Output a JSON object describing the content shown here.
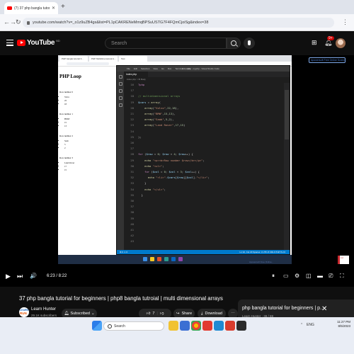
{
  "browser": {
    "tab_title": "(7) 37 php bangla tutorial for be",
    "tab_close": "✕",
    "new_tab": "+",
    "back": "←",
    "forward": "→",
    "reload": "↻",
    "url": "youtube.com/watch?v=_o1z9uZB4gs&list=PL1pCAKRENeMmqBPSuUSTG7F4FQmCjoiSg&index=38",
    "menu": "⋮"
  },
  "youtube_header": {
    "logo_text": "YouTube",
    "logo_cc": "BD",
    "search_placeholder": "Search",
    "notification_count": "9+"
  },
  "video_frame": {
    "inner_tabs": [
      "PHP bangla tutorial 3...",
      "PHP Multidimensional A...",
      "Test"
    ],
    "webpage": {
      "title": "PHP Loop",
      "sections": [
        {
          "title": "Row number 0",
          "items": [
            "Volvo",
            "22",
            "18"
          ]
        },
        {
          "title": "Row number 1",
          "items": [
            "BMW",
            "15",
            "13"
          ]
        },
        {
          "title": "Row number 2",
          "items": [
            "Saab",
            "5",
            "2"
          ]
        },
        {
          "title": "Row number 3",
          "items": [
            "Land Rover",
            "17",
            "15"
          ]
        }
      ]
    },
    "vscode": {
      "menu": [
        "File",
        "Edit",
        "Selection",
        "View",
        "Go",
        "Run",
        "Terminal",
        "Help"
      ],
      "window_title": "index.php - myphp - Visual Studio Code",
      "tab": "index.php",
      "breadcrumb": "index.php > ⚙ Body",
      "line_numbers": [
        "16",
        "17",
        "18",
        "19",
        "20",
        "21",
        "22",
        "23",
        "24",
        "25",
        "26",
        "27",
        "28",
        "29",
        "30",
        "31",
        "32",
        "33",
        "34",
        "35",
        "36",
        "37",
        "38",
        "39",
        "40",
        "41",
        "42",
        "43"
      ],
      "status_left": "⊗ 0 ⚠ 0",
      "status_right": "Ln 32, Col 29   Spaces: 4   UTF-8   CRLF   PHP   8.2.0"
    },
    "watermark": "Apowersoft Free Online Screen Recorder",
    "credit": "Apowersoft Free Online...",
    "chip_text": "LH"
  },
  "player": {
    "progress_fraction": 0.76,
    "time": "6:23 / 8:22",
    "play_icon": "▶",
    "next_icon": "⏭",
    "volume_icon": "🔊"
  },
  "video_info": {
    "title": "37 php bangla tutorial for beginners | php8 bangla tutroial | multi dimensional arrays",
    "channel": "Learn Hunter",
    "subscribers": "29.1K subscribers",
    "channel_logo_top": "LEARN",
    "channel_logo_bottom": "RUN",
    "subscribe_label": "Subscribed",
    "likes": "7",
    "share_label": "Share",
    "download_label": "Download",
    "more": "⋯"
  },
  "playlist": {
    "title": "php bangla tutorial for beginners | p...",
    "subtitle": "Learn Hunter · 38 / 69",
    "close": "✕"
  },
  "taskbar": {
    "search_label": "Search",
    "time": "11:27 PM",
    "date": "8/5/2023",
    "language": "ENG"
  }
}
